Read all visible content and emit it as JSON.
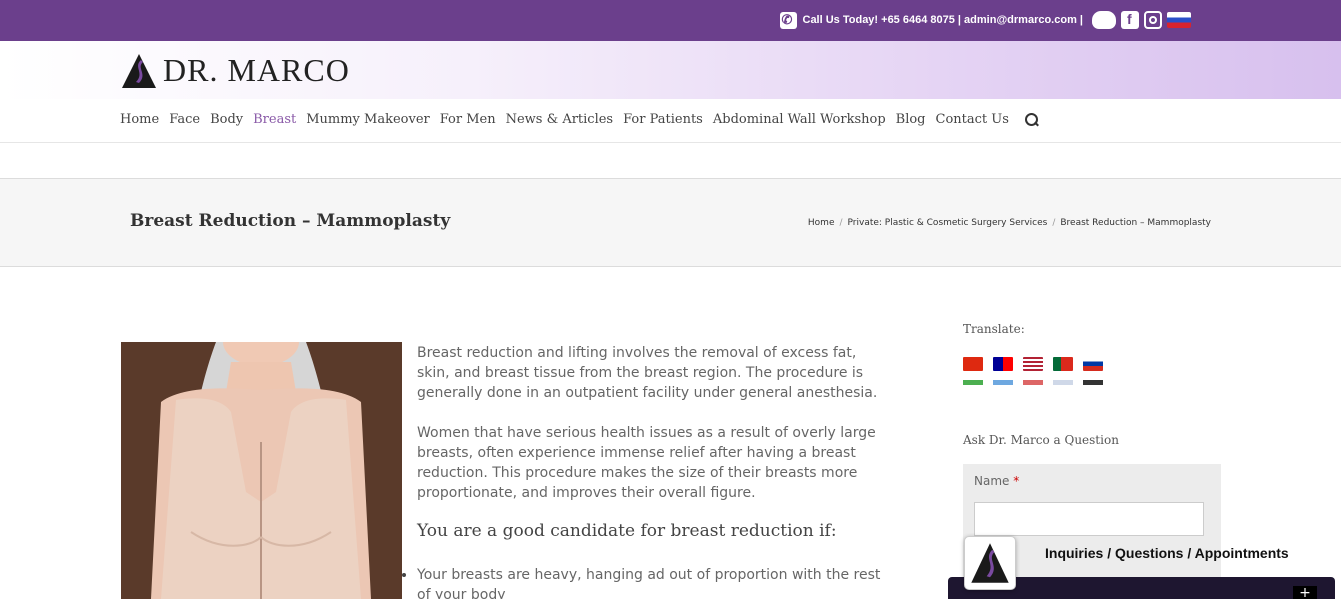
{
  "topbar": {
    "call_text": "Call Us Today! +65 6464 8075 | admin@drmarco.com |",
    "icons": [
      "phone-icon",
      "weibo-icon",
      "facebook-icon",
      "instagram-icon",
      "russian-flag-icon"
    ],
    "bg_color": "#6b3f8c"
  },
  "header": {
    "logo_text": "DR. MARCO"
  },
  "nav": {
    "items": [
      {
        "label": "Home"
      },
      {
        "label": "Face"
      },
      {
        "label": "Body"
      },
      {
        "label": "Breast",
        "active": true
      },
      {
        "label": "Mummy Makeover"
      },
      {
        "label": "For Men"
      },
      {
        "label": "News & Articles"
      },
      {
        "label": "For Patients"
      },
      {
        "label": "Abdominal Wall Workshop"
      },
      {
        "label": "Blog"
      },
      {
        "label": "Contact Us"
      }
    ],
    "active_color": "#8a5aa8"
  },
  "page": {
    "title": "Breast Reduction – Mammoplasty",
    "breadcrumb": [
      "Home",
      "Private: Plastic & Cosmetic Surgery Services",
      "Breast Reduction – Mammoplasty"
    ]
  },
  "content": {
    "para1": "Breast reduction and lifting involves the removal of excess fat, skin, and breast tissue from the breast region. The procedure is generally done in an outpatient facility under general anesthesia.",
    "para2": "Women that have serious health issues as a result of overly large breasts, often experience immense relief after having a breast reduction. This procedure makes the size of their breasts more proportionate, and improves their overall figure.",
    "heading": "You are a good candidate for breast reduction if:",
    "bullets": [
      "Your breasts are heavy, hanging ad out of proportion with the rest of your body"
    ]
  },
  "sidebar": {
    "translate_heading": "Translate:",
    "flags": [
      "china-flag",
      "taiwan-flag",
      "usa-flag",
      "portugal-flag",
      "russia-flag"
    ],
    "ask_heading": "Ask Dr. Marco a Question",
    "name_label": "Name",
    "required_mark": "*"
  },
  "chat": {
    "label": "Inquiries / Questions / Appointments",
    "expand_symbol": "+"
  }
}
